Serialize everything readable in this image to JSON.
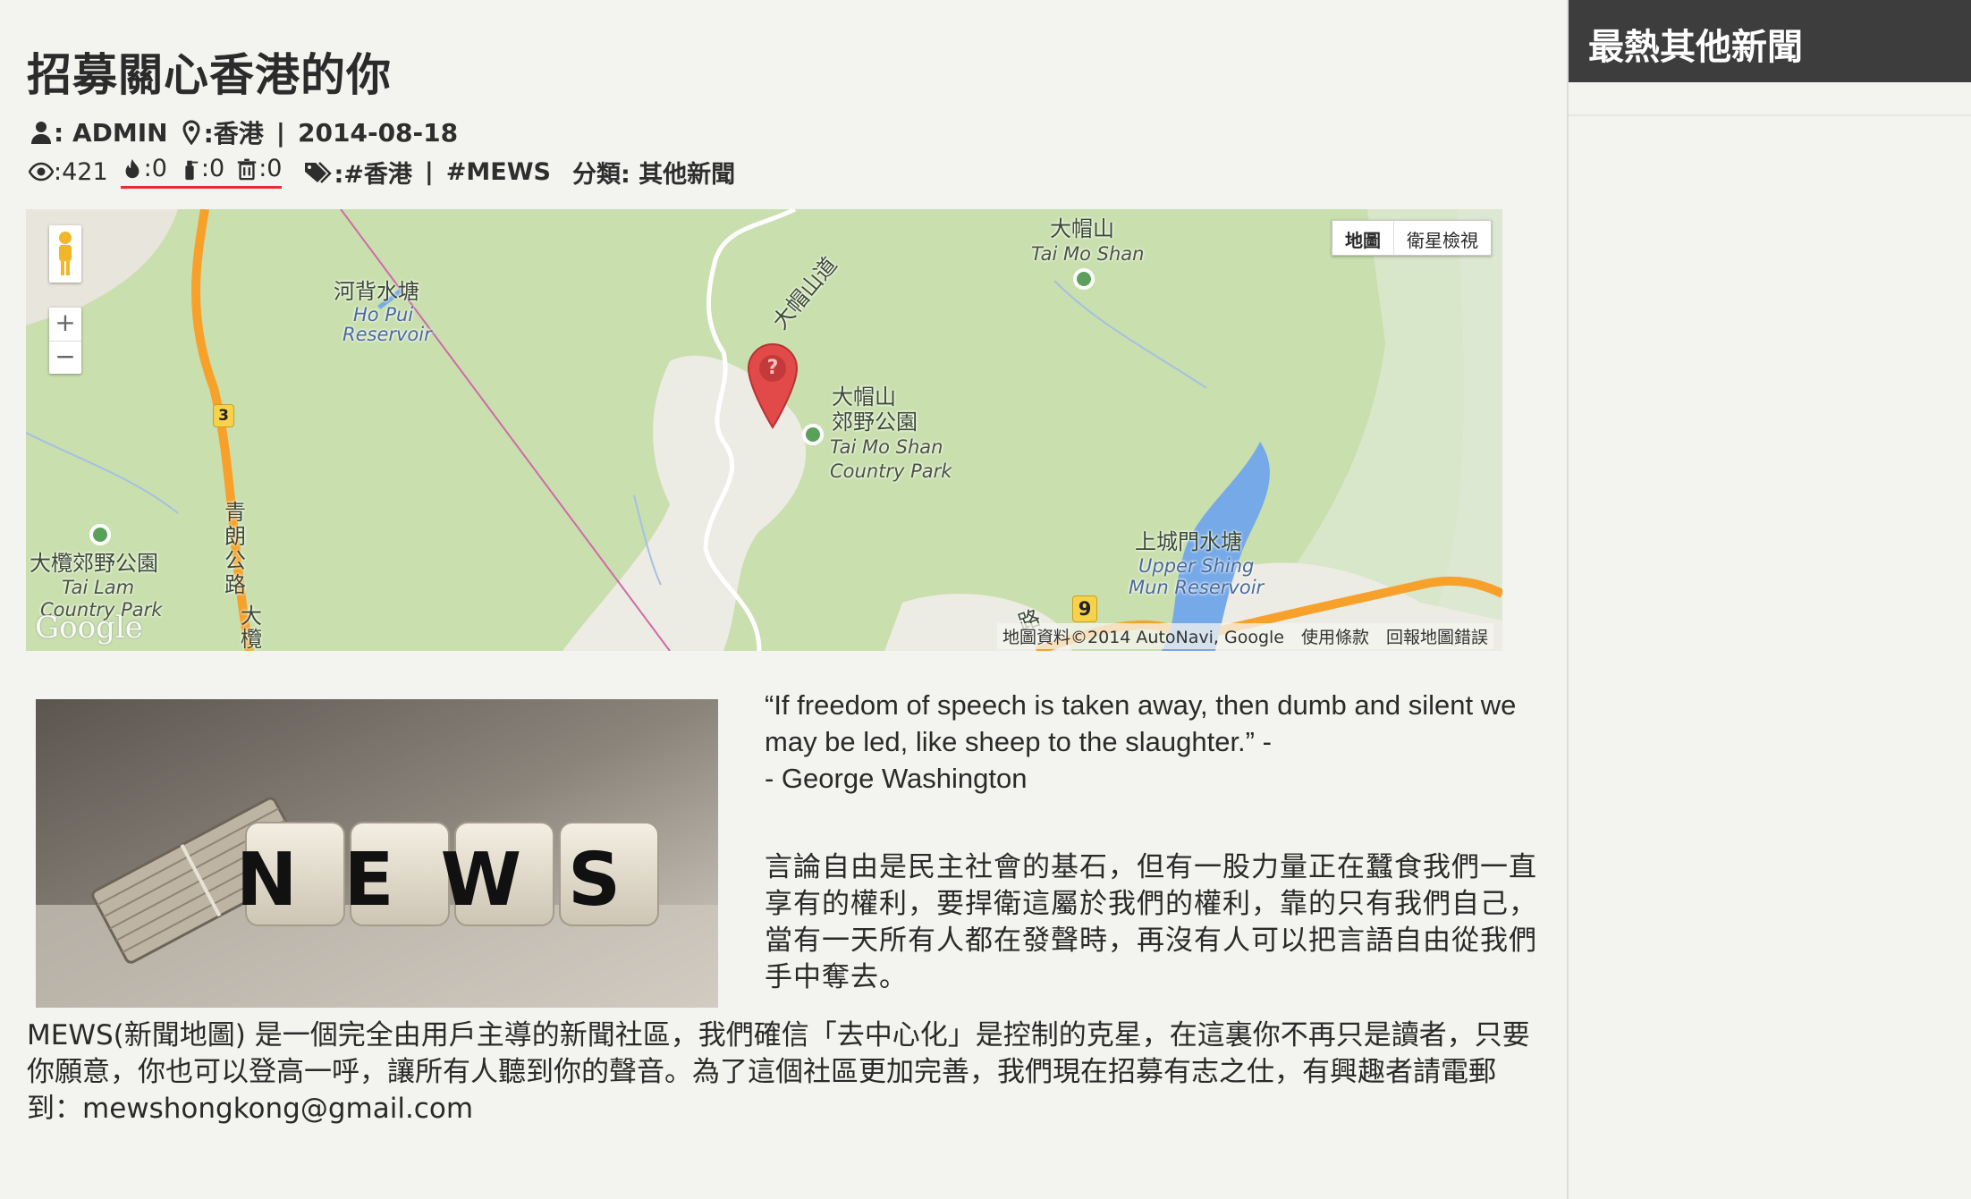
{
  "article": {
    "title": "招募關心香港的你",
    "author_label": ": ADMIN",
    "location_label": ":香港",
    "date": "2014-08-18",
    "views": ":421",
    "reactions": [
      {
        "icon": "fire-icon",
        "count": ":0"
      },
      {
        "icon": "fire-extinguisher-icon",
        "count": ":0"
      },
      {
        "icon": "trash-icon",
        "count": ":0"
      }
    ],
    "tags_prefix": ":#香港",
    "tag2": "#MEWS",
    "category": "分類: 其他新聞",
    "quote": "“If freedom of speech is taken away, then dumb and silent we may be led, like sheep to the slaughter.” -\n- George Washington",
    "paragraph1": "言論自由是民主社會的基石，但有一股力量正在蠶食我們一直享有的權利，要捍衛這屬於我們的權利，靠的只有我們自己，當有一天所有人都在發聲時，再沒有人可以把言語自由從我們手中奪去。",
    "paragraph2": "MEWS(新聞地圖) 是一個完全由用戶主導的新聞社區，我們確信「去中心化」是控制的克星，在這裏你不再只是讀者，只要你願意，你也可以登高一呼，讓所有人聽到你的聲音。為了這個社區更加完善，我們現在招募有志之仕，有興趣者請電郵到：mewshongkong@gmail.com",
    "image_text": "NEWS"
  },
  "map": {
    "type_map": "地圖",
    "type_satellite": "衛星檢視",
    "zoom_in": "+",
    "zoom_out": "−",
    "attribution": "地圖資料©2014 AutoNavi, Google　使用條款　回報地圖錯誤",
    "logo": "Google",
    "labels": {
      "tai_mo_shan_zh": "大帽山",
      "tai_mo_shan_en": "Tai Mo Shan",
      "ho_pui_zh": "河背水塘",
      "ho_pui_en1": "Ho Pui",
      "ho_pui_en2": "Reservoir",
      "road_tms": "大帽山道",
      "park_zh1": "大帽山",
      "park_zh2": "郊野公園",
      "park_en1": "Tai Mo Shan",
      "park_en2": "Country Park",
      "tai_lam_zh": "大欖郊野公園",
      "tai_lam_en1": "Tai Lam",
      "tai_lam_en2": "Country Park",
      "shing_mun_zh": "上城門水塘",
      "shing_mun_en1": "Upper Shing",
      "shing_mun_en2": "Mun Reservoir",
      "road_3": "3",
      "road_9": "9",
      "ching_long": "青朗公路",
      "tai_lam_road": "大欖",
      "road_fragment": "路"
    },
    "marker_symbol": "?"
  },
  "sidebar": {
    "heading": "最熱其他新聞"
  },
  "colors": {
    "background": "#f3f3ef",
    "sidebar_header": "#3d3d3d",
    "reaction_underline": "#e03030",
    "map_green": "#c9dfae",
    "marker_red": "#e24a4a"
  }
}
